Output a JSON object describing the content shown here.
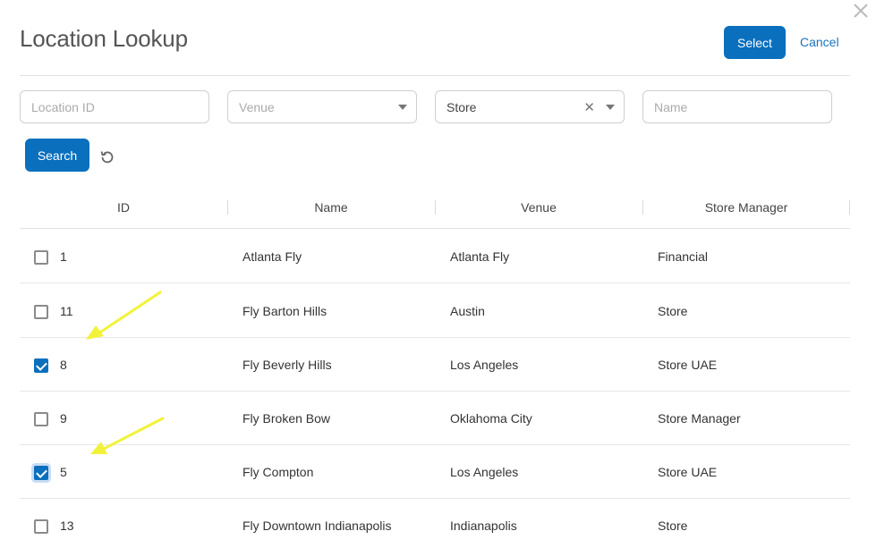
{
  "dialog": {
    "title": "Location Lookup",
    "select_label": "Select",
    "cancel_label": "Cancel"
  },
  "filters": {
    "location_id_placeholder": "Location ID",
    "venue_placeholder": "Venue",
    "type_value": "Store",
    "name_placeholder": "Name"
  },
  "actions": {
    "search_label": "Search"
  },
  "table": {
    "headers": [
      "ID",
      "Name",
      "Venue",
      "Store Manager"
    ],
    "rows": [
      {
        "checked": false,
        "id": "1",
        "name": "Atlanta Fly",
        "venue": "Atlanta Fly",
        "manager": "Financial"
      },
      {
        "checked": false,
        "id": "11",
        "name": "Fly Barton Hills",
        "venue": "Austin",
        "manager": "Store"
      },
      {
        "checked": true,
        "id": "8",
        "name": "Fly Beverly Hills",
        "venue": "Los Angeles",
        "manager": "Store UAE"
      },
      {
        "checked": false,
        "id": "9",
        "name": "Fly Broken Bow",
        "venue": "Oklahoma City",
        "manager": "Store Manager"
      },
      {
        "checked": true,
        "id": "5",
        "name": "Fly Compton",
        "venue": "Los Angeles",
        "manager": "Store UAE"
      },
      {
        "checked": false,
        "id": "13",
        "name": "Fly Downtown Indianapolis",
        "venue": "Indianapolis",
        "manager": "Store"
      }
    ]
  },
  "colors": {
    "primary": "#0a6fbd",
    "annotation_arrow": "#f2f23a"
  }
}
